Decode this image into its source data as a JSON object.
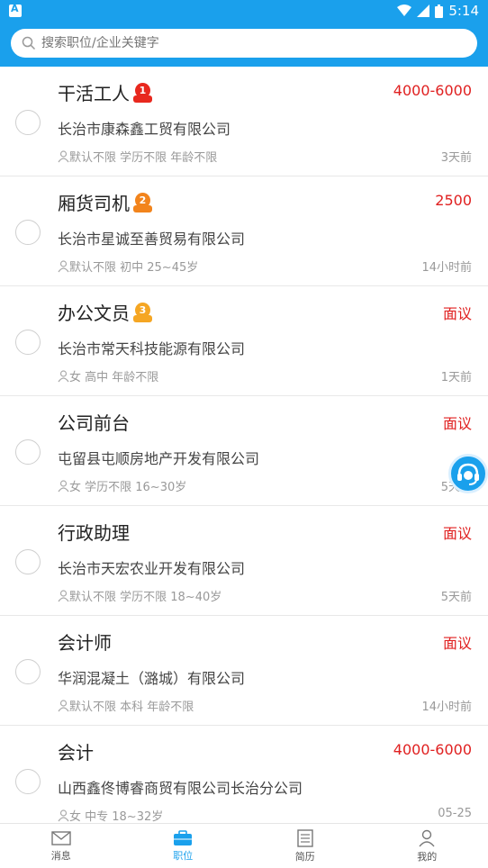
{
  "status_bar": {
    "time": "5:14"
  },
  "search": {
    "placeholder": "搜索职位/企业关键字"
  },
  "jobs": [
    {
      "title": "干活工人",
      "rank": "1",
      "salary": "4000-6000",
      "company": "长治市康森鑫工贸有限公司",
      "requirements": "默认不限 学历不限 年龄不限",
      "posted": "3天前"
    },
    {
      "title": "厢货司机",
      "rank": "2",
      "salary": "2500",
      "company": "长治市星诚至善贸易有限公司",
      "requirements": "默认不限 初中 25~45岁",
      "posted": "14小时前"
    },
    {
      "title": "办公文员",
      "rank": "3",
      "salary": "面议",
      "company": "长治市常天科技能源有限公司",
      "requirements": "女 高中 年龄不限",
      "posted": "1天前"
    },
    {
      "title": "公司前台",
      "salary": "面议",
      "company": "屯留县屯顺房地产开发有限公司",
      "requirements": "女 学历不限 16~30岁",
      "posted": "5天前"
    },
    {
      "title": "行政助理",
      "salary": "面议",
      "company": "长治市天宏农业开发有限公司",
      "requirements": "默认不限 学历不限 18~40岁",
      "posted": "5天前"
    },
    {
      "title": "会计师",
      "salary": "面议",
      "company": "华润混凝土（潞城）有限公司",
      "requirements": "默认不限 本科 年龄不限",
      "posted": "14小时前"
    },
    {
      "title": "会计",
      "salary": "4000-6000",
      "company": "山西鑫佟博睿商贸有限公司长治分公司",
      "requirements": "女 中专 18~32岁",
      "posted": "05-25"
    }
  ],
  "tabs": [
    {
      "label": "消息",
      "icon": "mail-icon"
    },
    {
      "label": "职位",
      "icon": "briefcase-icon",
      "active": true
    },
    {
      "label": "简历",
      "icon": "resume-icon"
    },
    {
      "label": "我的",
      "icon": "person-icon"
    }
  ],
  "colors": {
    "brand": "#1aa0ec",
    "salary": "#e02020",
    "medal_gold": "#f5a623",
    "medal_red": "#e8281e",
    "medal_orange": "#f2841c"
  }
}
